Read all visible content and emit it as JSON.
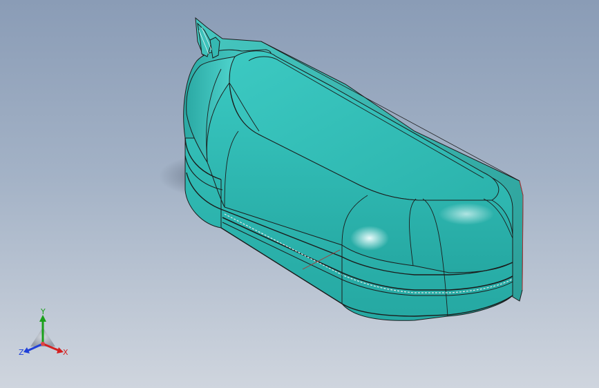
{
  "viewport": {
    "background_top": "#8a9cb6",
    "background_bottom": "#cfd5de"
  },
  "model": {
    "body_color": "#2fbdb6",
    "edge_color": "#1b1b1b",
    "highlight_color": "#e9ffff"
  },
  "triad": {
    "x_label": "X",
    "y_label": "Y",
    "z_label": "Z",
    "x_color": "#d42020",
    "y_color": "#1aa01a",
    "z_color": "#2040d8"
  }
}
